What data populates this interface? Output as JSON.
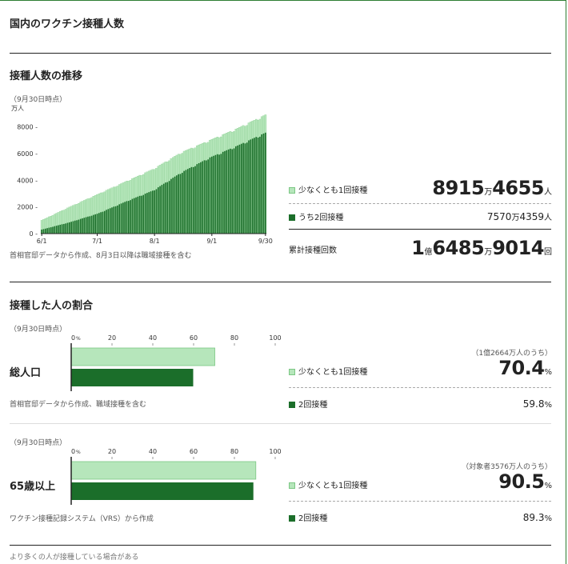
{
  "page_title": "国内のワクチン接種人数",
  "trend": {
    "heading": "接種人数の推移",
    "as_of": "（9月30日時点）",
    "note": "首相官邸データから作成、8月3日以降は職域接種を含む",
    "legend_atleast1": "少なくとも1回接種",
    "legend_2doses": "うち2回接種",
    "atleast1_man": "8915",
    "atleast1_rest": "4655",
    "two_man": "7570",
    "two_rest": "4359",
    "total_label": "累計接種回数",
    "total_oku": "1",
    "total_man": "6485",
    "total_rest": "9014",
    "unit_oku": "億",
    "unit_man": "万",
    "unit_nin": "人",
    "unit_kai": "回"
  },
  "share": {
    "heading": "接種した人の割合",
    "as_of_1": "（9月30日時点）",
    "as_of_2": "（9月30日時点）",
    "total_row_label": "総人口",
    "total_row_note": "首相官邸データから作成、職域接種を含む",
    "total_denominator": "（1億2664万人のうち）",
    "total_atleast1_label": "少なくとも1回接種",
    "total_atleast1": "70.4",
    "total_2doses_label": "2回接種",
    "total_2doses": "59.8",
    "senior_row_label": "65歳以上",
    "senior_row_note": "ワクチン接種記録システム（VRS）から作成",
    "senior_denominator": "（対象者3576万人のうち）",
    "senior_atleast1_label": "少なくとも1回接種",
    "senior_atleast1": "90.5",
    "senior_2doses_label": "2回接種",
    "senior_2doses": "89.3",
    "pct": "%"
  },
  "footer_note": "より多くの人が接種している場合がある",
  "colors": {
    "light": "#b6e6bb",
    "light_edge": "#7cc784",
    "dark": "#1b6e2a"
  },
  "chart_data": [
    {
      "type": "bar",
      "stacked": false,
      "unit_label": "万人",
      "x_tick_labels": [
        "6/1",
        "7/1",
        "8/1",
        "9/1",
        "9/30"
      ],
      "x": [
        "6/1",
        "6/15",
        "7/1",
        "7/15",
        "8/1",
        "8/15",
        "9/1",
        "9/15",
        "9/30"
      ],
      "series": [
        {
          "name": "少なくとも1回接種",
          "values": [
            1000,
            2000,
            2950,
            3900,
            4850,
            6100,
            7000,
            7900,
            8915
          ]
        },
        {
          "name": "うち2回接種",
          "values": [
            300,
            850,
            1500,
            2400,
            3250,
            4600,
            5700,
            6600,
            7570
          ]
        }
      ],
      "ylim": [
        0,
        9000
      ],
      "y_ticks": [
        0,
        2000,
        4000,
        6000,
        8000
      ],
      "y_tick_labels": [
        "0 -",
        "2000 -",
        "4000 -",
        "6000 -",
        "8000 -"
      ]
    },
    {
      "type": "bar",
      "orientation": "horizontal",
      "categories": [
        "総人口"
      ],
      "series": [
        {
          "name": "少なくとも1回接種",
          "values": [
            70.4
          ]
        },
        {
          "name": "2回接種",
          "values": [
            59.8
          ]
        }
      ],
      "xlim": [
        0,
        100
      ],
      "x_ticks": [
        "0",
        "20",
        "40",
        "60",
        "80",
        "100"
      ],
      "x_unit": "%"
    },
    {
      "type": "bar",
      "orientation": "horizontal",
      "categories": [
        "65歳以上"
      ],
      "series": [
        {
          "name": "少なくとも1回接種",
          "values": [
            90.5
          ]
        },
        {
          "name": "2回接種",
          "values": [
            89.3
          ]
        }
      ],
      "xlim": [
        0,
        100
      ],
      "x_ticks": [
        "0",
        "20",
        "40",
        "60",
        "80",
        "100"
      ],
      "x_unit": "%"
    }
  ]
}
